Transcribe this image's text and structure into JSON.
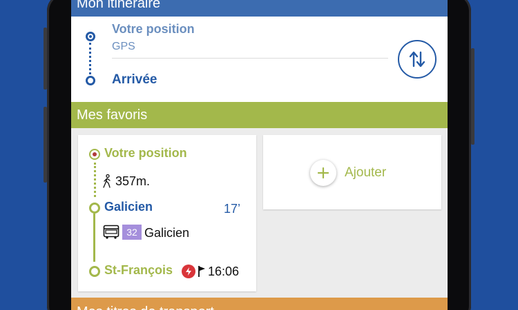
{
  "itinerary": {
    "header": "Mon itinéraire",
    "from_label": "Votre position",
    "from_sub": "GPS",
    "to_label": "Arrivée"
  },
  "favorites": {
    "header": "Mes favoris",
    "card": {
      "from": "Votre position",
      "walk_distance": "357m.",
      "stop": "Galicien",
      "stop_wait": "17’",
      "line_number": "32",
      "line_destination": "Galicien",
      "destination": "St-François",
      "arrival_time": "16:06"
    },
    "add_label": "Ajouter"
  },
  "titles_header": "Mes titres de transport",
  "colors": {
    "background": "#1f4f9e",
    "itinerary_blue": "#3c6cb0",
    "favorites_green": "#a3b84b",
    "titles_orange": "#dd9a4a",
    "line_badge_purple": "#a58fdc",
    "alert_red": "#d9353a"
  },
  "icons": [
    "swap-icon",
    "walk-icon",
    "bus-icon",
    "alert-icon",
    "flag-icon",
    "plus-icon"
  ]
}
